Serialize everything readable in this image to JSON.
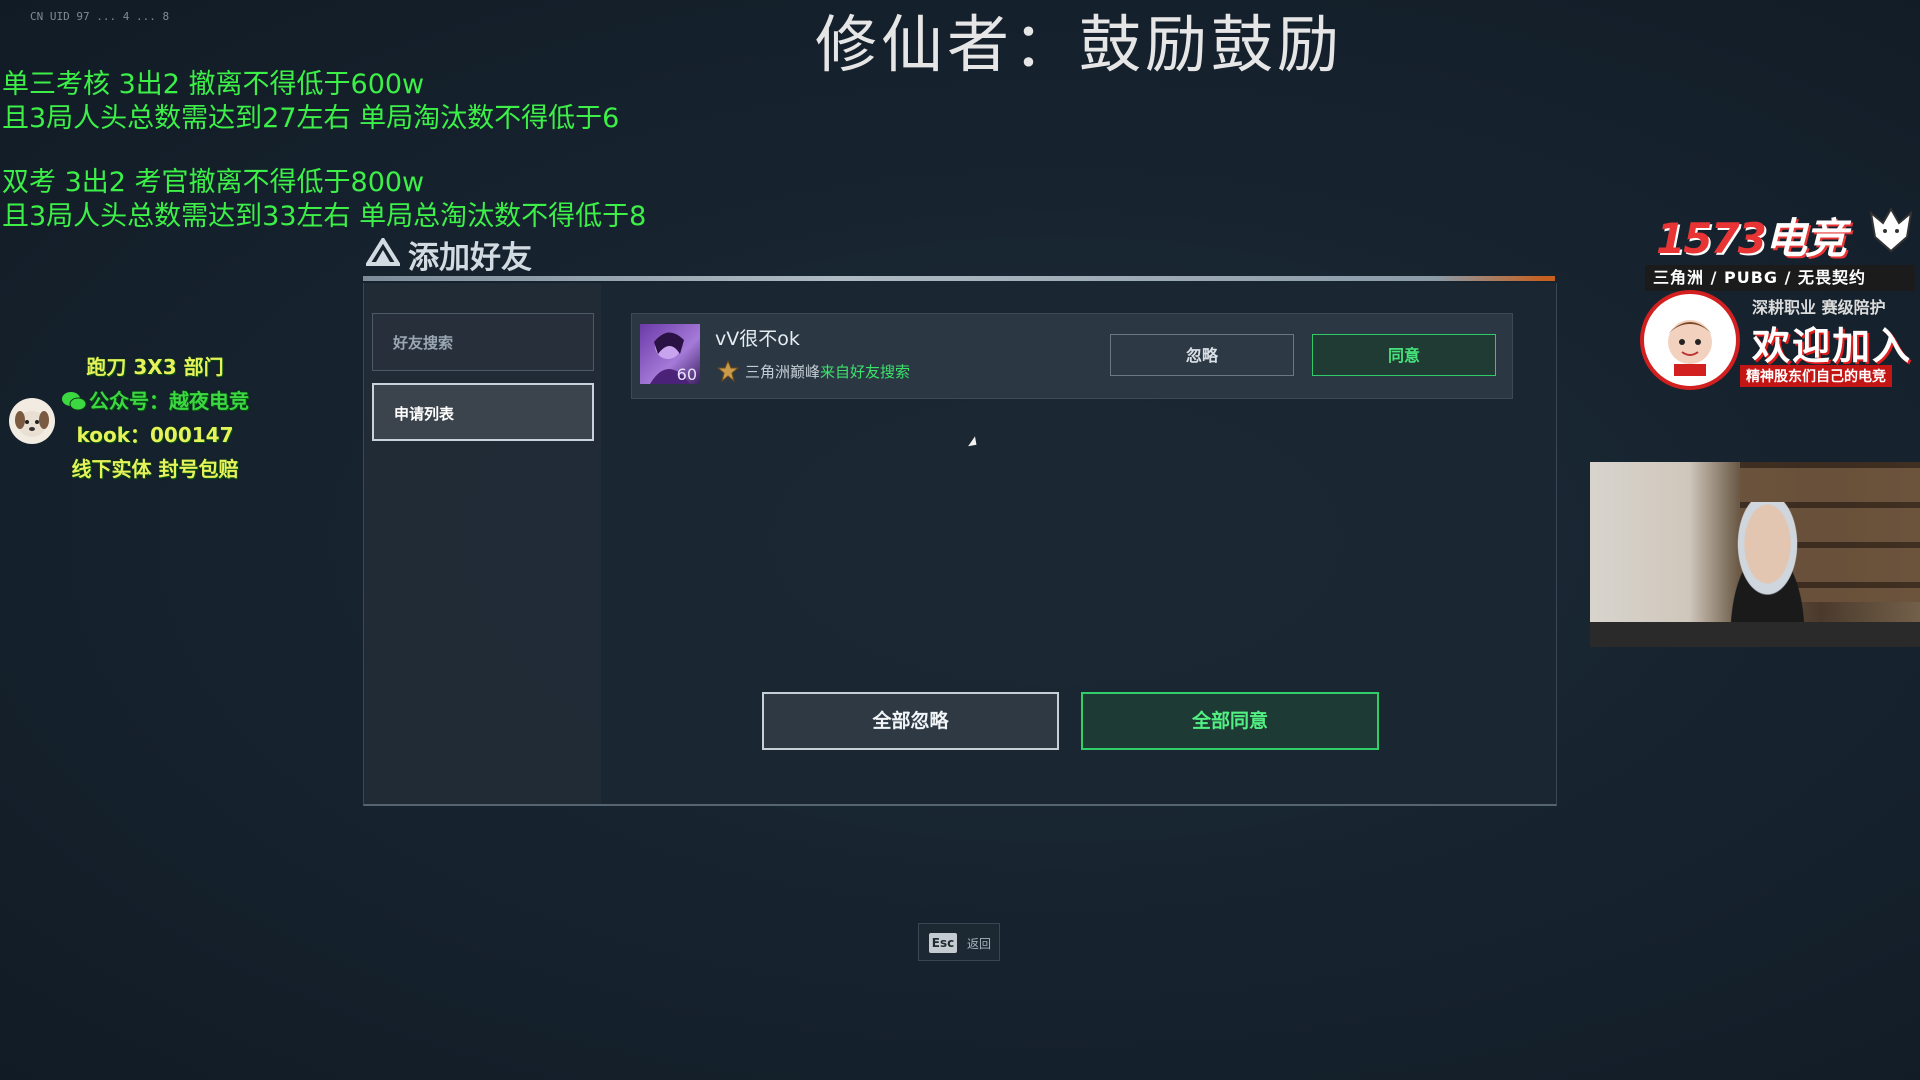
{
  "stream_overlay": {
    "stream_id": "CN UID 97 ... 4 ... 8",
    "rule_lines_1": [
      "单三考核 3出2 撤离不得低于600w",
      "且3局人头总数需达到27左右 单局淘汰数不得低于6"
    ],
    "rule_lines_2": [
      "双考 3出2 考官撤离不得低于800w",
      "且3局人头总数需达到33左右 单局总淘汰数不得低于8"
    ],
    "headline": "修仙者：鼓励鼓励",
    "promo_left": {
      "line1": "跑刀 3X3 部门",
      "line2": "公众号：越夜电竞",
      "line3": "kook：000147",
      "line4": "线下实体 封号包赔"
    },
    "promo_right": {
      "brand_a": "1573",
      "brand_b": "电竞",
      "games": "三角洲 / PUBG / 无畏契约",
      "tags": "深耕职业  赛级陪护",
      "welcome": "欢迎加入",
      "motto": "精神股东们自己的电竞"
    }
  },
  "dialog": {
    "title": "添加好友",
    "sidebar": {
      "items": [
        {
          "label": "好友搜索",
          "active": false
        },
        {
          "label": "申请列表",
          "active": true
        }
      ]
    },
    "requests": [
      {
        "name": "vV很不ok",
        "level": "60",
        "rank": "三角洲巅峰",
        "source": "来自好友搜索",
        "ignore_label": "忽略",
        "agree_label": "同意"
      }
    ],
    "ignore_all_label": "全部忽略",
    "agree_all_label": "全部同意"
  },
  "footer": {
    "esc_key": "Esc",
    "esc_label": "返回"
  },
  "colors": {
    "accent_green": "#3ce26b",
    "overlay_green": "#3cf048",
    "brand_red": "#e83434"
  }
}
